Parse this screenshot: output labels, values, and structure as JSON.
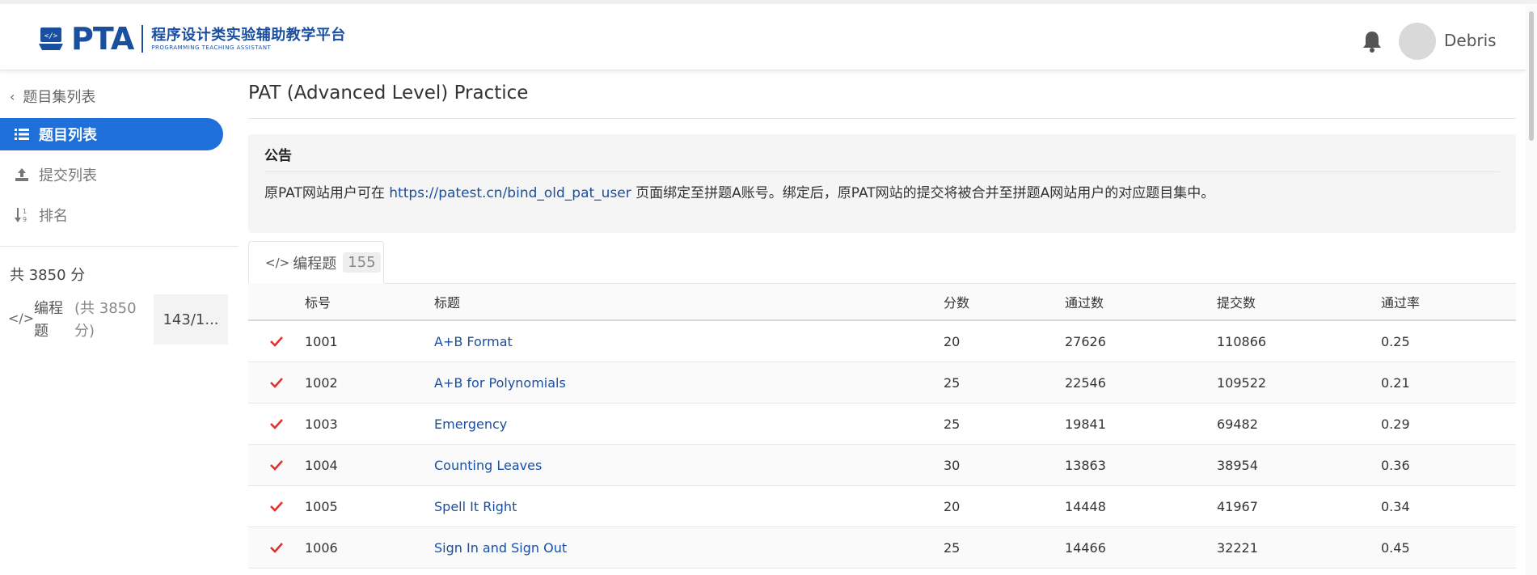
{
  "header": {
    "logo_text": "PTA",
    "logo_cn": "程序设计类实验辅助教学平台",
    "logo_en": "PROGRAMMING TEACHING ASSISTANT",
    "username": "Debris"
  },
  "sidebar": {
    "back_label": "题目集列表",
    "items": [
      {
        "label": "题目列表",
        "icon": "list-icon",
        "active": true
      },
      {
        "label": "提交列表",
        "icon": "upload-icon",
        "active": false
      },
      {
        "label": "排名",
        "icon": "sort-icon",
        "active": false
      }
    ],
    "total": "共 3850 分",
    "category": {
      "name": "编程题",
      "score": "(共 3850 分)",
      "progress": "143/1..."
    }
  },
  "main": {
    "title": "PAT (Advanced Level) Practice",
    "notice": {
      "title": "公告",
      "body_prefix": "原PAT网站用户可在 ",
      "link": "https://patest.cn/bind_old_pat_user",
      "body_suffix": " 页面绑定至拼题A账号。绑定后，原PAT网站的提交将被合并至拼题A网站用户的对应题目集中。"
    },
    "tab": {
      "label": "编程题",
      "count": "155"
    },
    "table": {
      "headers": [
        "标号",
        "标题",
        "分数",
        "通过数",
        "提交数",
        "通过率"
      ],
      "rows": [
        {
          "id": "1001",
          "title": "A+B Format",
          "score": "20",
          "passed": "27626",
          "submitted": "110866",
          "rate": "0.25"
        },
        {
          "id": "1002",
          "title": "A+B for Polynomials",
          "score": "25",
          "passed": "22546",
          "submitted": "109522",
          "rate": "0.21"
        },
        {
          "id": "1003",
          "title": "Emergency",
          "score": "25",
          "passed": "19841",
          "submitted": "69482",
          "rate": "0.29"
        },
        {
          "id": "1004",
          "title": "Counting Leaves",
          "score": "30",
          "passed": "13863",
          "submitted": "38954",
          "rate": "0.36"
        },
        {
          "id": "1005",
          "title": "Spell It Right",
          "score": "20",
          "passed": "14448",
          "submitted": "41967",
          "rate": "0.34"
        },
        {
          "id": "1006",
          "title": "Sign In and Sign Out",
          "score": "25",
          "passed": "14466",
          "submitted": "32221",
          "rate": "0.45"
        }
      ]
    }
  },
  "colors": {
    "accent": "#1e6fd9",
    "brand": "#1a4fa0",
    "check": "#e03030"
  }
}
